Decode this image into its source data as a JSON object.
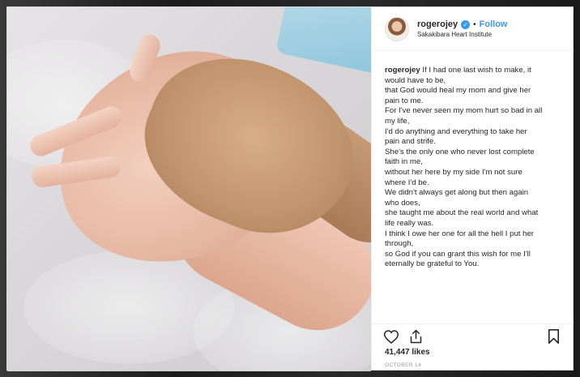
{
  "header": {
    "username": "rogerojey",
    "follow_label": "Follow",
    "dot": "•",
    "location": "Sakakibara Heart Institute"
  },
  "caption": {
    "username": "rogerojey",
    "lines": [
      "If I had one last wish to make, it",
      "would have to be,",
      "that God would heal my mom and give her",
      "pain to me.",
      "For I've never seen my mom hurt so bad in all",
      "my life,",
      "I'd do anything and everything to take her",
      "pain and strife.",
      "She's the only one who never lost complete",
      "faith in me,",
      "without her here by my side I'm not sure",
      "where I'd be.",
      "We didn't always get along but then again",
      "who does,",
      "she taught me about the real world and what",
      "life really was.",
      "I think I owe her one for all the hell I put her",
      "through,",
      "so God if you can grant this wish for me I'll",
      "eternally be grateful to You."
    ]
  },
  "footer": {
    "likes": "41,447 likes",
    "date": "OCTOBER 14"
  },
  "icons": {
    "verified": "verified-badge-icon",
    "like": "heart-icon",
    "share": "share-icon",
    "save": "bookmark-icon"
  },
  "colors": {
    "link": "#3897f0",
    "text": "#262626",
    "muted": "#999999"
  }
}
